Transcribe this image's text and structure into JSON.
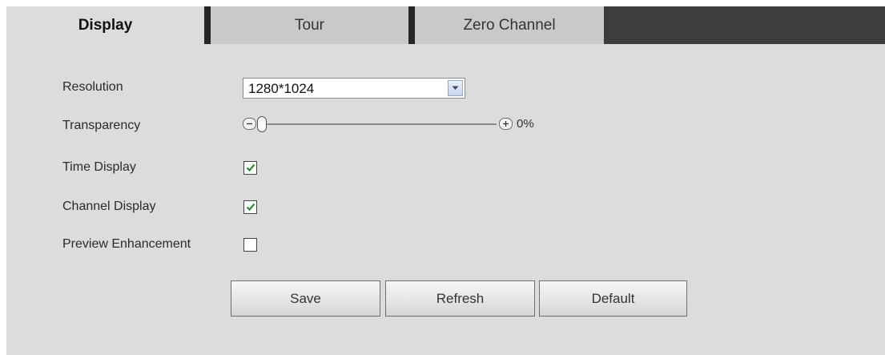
{
  "tabs": {
    "display": "Display",
    "tour": "Tour",
    "zero_channel": "Zero Channel"
  },
  "form": {
    "resolution": {
      "label": "Resolution",
      "value": "1280*1024"
    },
    "transparency": {
      "label": "Transparency",
      "value_text": "0%",
      "value": 0
    },
    "time_display": {
      "label": "Time Display",
      "checked": true
    },
    "channel_display": {
      "label": "Channel Display",
      "checked": true
    },
    "preview_enhancement": {
      "label": "Preview Enhancement",
      "checked": false
    }
  },
  "buttons": {
    "save": "Save",
    "refresh": "Refresh",
    "default": "Default"
  },
  "colors": {
    "panel_bg": "#dcdcdc",
    "tabbar_bg": "#3d3d3d",
    "check_color": "#2e8b2e"
  },
  "icons": {
    "dropdown": "chevron-down-icon",
    "minus": "minus-icon",
    "plus": "plus-icon",
    "check": "check-icon"
  }
}
